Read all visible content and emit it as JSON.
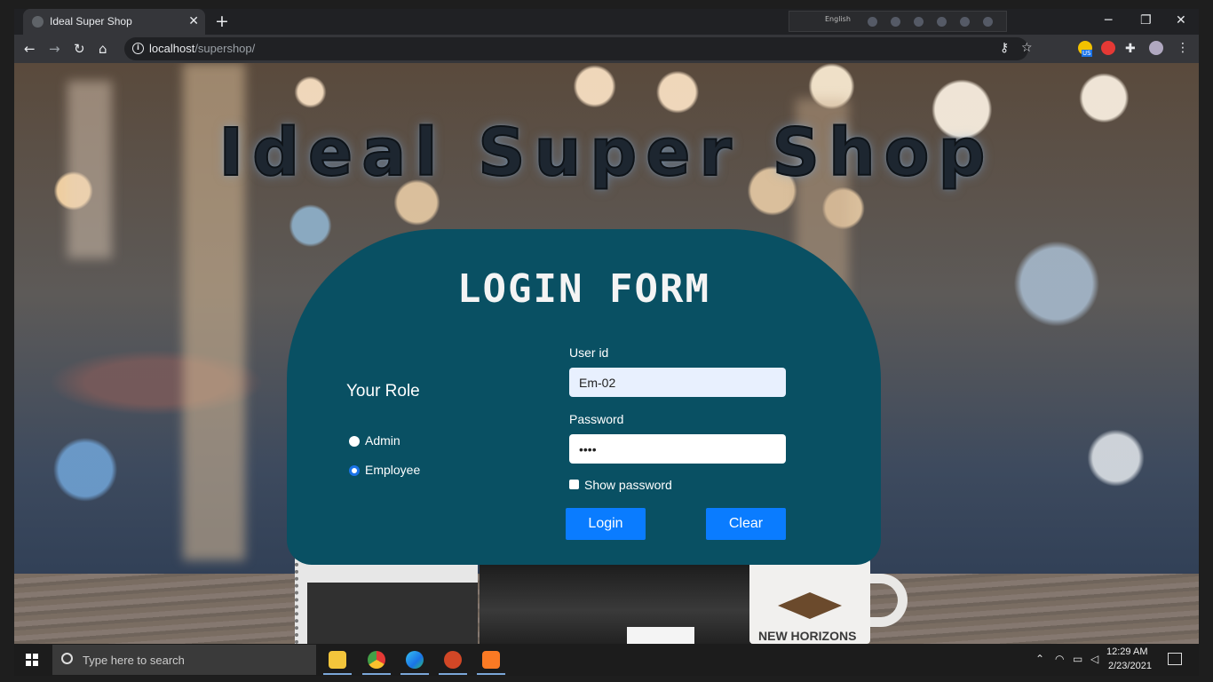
{
  "browser": {
    "tab_title": "Ideal Super Shop",
    "tab_close": "✕",
    "new_tab": "+",
    "language_label": "English",
    "url_host": "localhost",
    "url_path": "/supershop/",
    "window_controls": {
      "minimize": "─",
      "restore": "❐",
      "close": "✕"
    },
    "nav": {
      "back": "←",
      "forward": "→",
      "reload": "↻",
      "home": "⌂"
    },
    "omnibox_icons": {
      "key": "key-icon",
      "bookmark": "☆"
    },
    "extension_badge": "US"
  },
  "page": {
    "site_title": "Ideal Super Shop",
    "form_title": "LOGIN FORM",
    "role_heading": "Your Role",
    "roles": [
      {
        "label": "Admin",
        "checked": false
      },
      {
        "label": "Employee",
        "checked": true
      }
    ],
    "userid_label": "User id",
    "userid_value": "Em-02",
    "password_label": "Password",
    "password_value": "••••",
    "show_password_label": "Show password",
    "show_password_checked": false,
    "login_button": "Login",
    "clear_button": "Clear",
    "mug_text": "NEW HORIZONS"
  },
  "taskbar": {
    "search_placeholder": "Type here to search",
    "apps": [
      "file-explorer",
      "chrome",
      "edge",
      "powerpoint",
      "xampp"
    ],
    "time": "12:29 AM",
    "date": "2/23/2021"
  },
  "colors": {
    "card": "#095063",
    "button": "#0a7cff",
    "browser_dark": "#202124",
    "browser_toolbar": "#35363a"
  }
}
